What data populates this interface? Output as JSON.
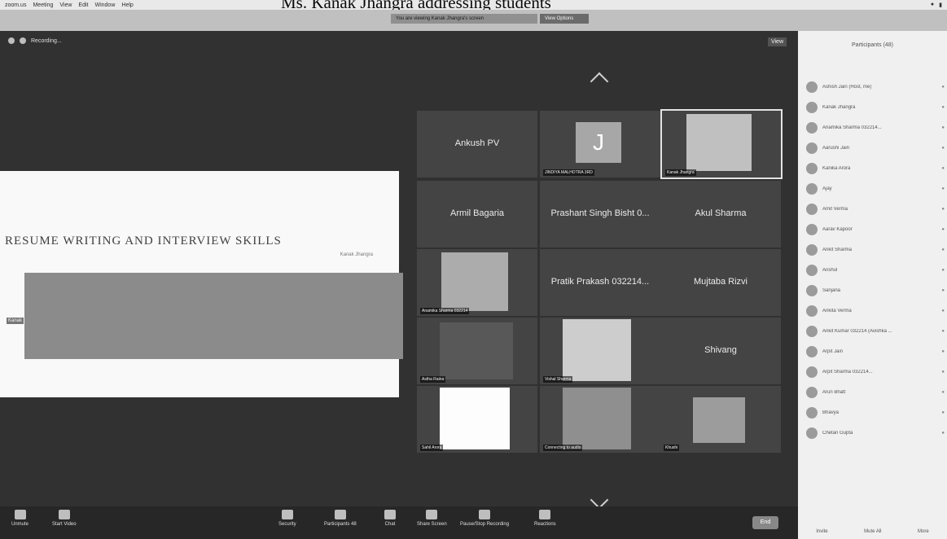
{
  "caption": "Ms. Kanak Jhangra addressing students",
  "mac_menu": [
    "zoom.us",
    "Meeting",
    "View",
    "Edit",
    "Window",
    "Help"
  ],
  "tabs": {
    "share": "You are viewing Kanak Jhangra's screen",
    "options": "View Options"
  },
  "recording": "Recording...",
  "view_label": "View",
  "slide": {
    "title": "RESUME WRITING AND INTERVIEW SKILLS",
    "subtitle": "Kanak Jhangra",
    "side_tag": "Kanak"
  },
  "tiles": [
    {
      "name": "Ankush PV",
      "label": ""
    },
    {
      "name": "",
      "label": "JINDIYA MALHOTRA 3RD",
      "letter": "J"
    },
    {
      "name": "",
      "label": "Kanak Jhangra"
    },
    {
      "name": "Armil Bagaria",
      "label": ""
    },
    {
      "name": "Prashant Singh Bisht 0...",
      "label": ""
    },
    {
      "name": "Akul Sharma",
      "label": ""
    },
    {
      "name": "",
      "label": "Anamika Sharma 032214"
    },
    {
      "name": "Pratik Prakash 032214...",
      "label": ""
    },
    {
      "name": "Mujtaba Rizvi",
      "label": ""
    },
    {
      "name": "",
      "label": "Astha Raina"
    },
    {
      "name": "",
      "label": "Vishal Sharma"
    },
    {
      "name": "Shivang",
      "label": ""
    },
    {
      "name": "",
      "label": "Sahil Arora"
    },
    {
      "name": "",
      "label": "Connecting to audio"
    },
    {
      "name": "",
      "label": "Khushi"
    }
  ],
  "toolbar": [
    {
      "label": "Unmute"
    },
    {
      "label": "Start Video"
    },
    {
      "label": "Security"
    },
    {
      "label": "Participants",
      "count": "48"
    },
    {
      "label": "Chat"
    },
    {
      "label": "Share Screen"
    },
    {
      "label": "Pause/Stop Recording"
    },
    {
      "label": "Reactions"
    }
  ],
  "end_label": "End",
  "panel": {
    "title": "Participants (48)",
    "rows": [
      "Ashish Jain (Host, me)",
      "Kanak Jhangra",
      "Anamika Sharma 032214...",
      "Aarushi Jain",
      "Kanika Arora",
      "Ajay",
      "Amit Verma",
      "Aarav Kapoor",
      "Ankit Sharma",
      "Anshul",
      "Sanjana",
      "Ankita Verma",
      "Ankit Kumar 032214 (Avishka ...",
      "Arpit Jain",
      "Arpit Sharma 032214...",
      "Arun Bhatt",
      "Bhavya",
      "Chetan Gupta"
    ],
    "footer": [
      "Invite",
      "Mute All",
      "More"
    ]
  }
}
